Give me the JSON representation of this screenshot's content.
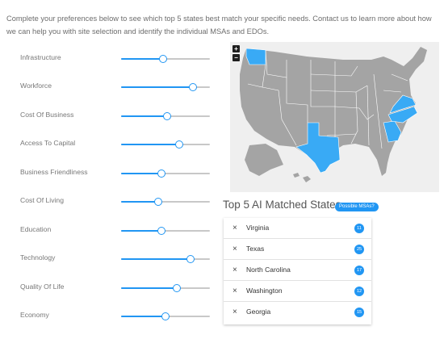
{
  "intro_text": "Complete your preferences below to see which top 5 states best match your specific needs. Contact us to learn more about how we can help you with site selection and identify the individual MSAs and EDOs.",
  "colors": {
    "accent": "#2196f3",
    "map_land": "#a4a4a4",
    "map_highlight": "#39aaf5",
    "map_border": "#ffffff",
    "track": "#c8c8c8"
  },
  "preferences": [
    {
      "label": "Infrastructure",
      "value": 0.47
    },
    {
      "label": "Workforce",
      "value": 0.81
    },
    {
      "label": "Cost Of Business",
      "value": 0.52
    },
    {
      "label": "Access To Capital",
      "value": 0.65
    },
    {
      "label": "Business Friendliness",
      "value": 0.45
    },
    {
      "label": "Cost Of Living",
      "value": 0.42
    },
    {
      "label": "Education",
      "value": 0.45
    },
    {
      "label": "Technology",
      "value": 0.78
    },
    {
      "label": "Quality Of Life",
      "value": 0.63
    },
    {
      "label": "Economy",
      "value": 0.5
    }
  ],
  "map": {
    "zoom_in_label": "+",
    "zoom_out_label": "−",
    "highlighted_states": [
      "Washington",
      "Texas",
      "Georgia",
      "North Carolina",
      "Virginia"
    ]
  },
  "results": {
    "title": "Top 5 AI Matched States",
    "msa_button_label": "Possible MSAs?",
    "remove_icon": "×",
    "states": [
      {
        "name": "Virginia",
        "count": "11"
      },
      {
        "name": "Texas",
        "count": "25"
      },
      {
        "name": "North Carolina",
        "count": "17"
      },
      {
        "name": "Washington",
        "count": "12"
      },
      {
        "name": "Georgia",
        "count": "15"
      }
    ]
  }
}
